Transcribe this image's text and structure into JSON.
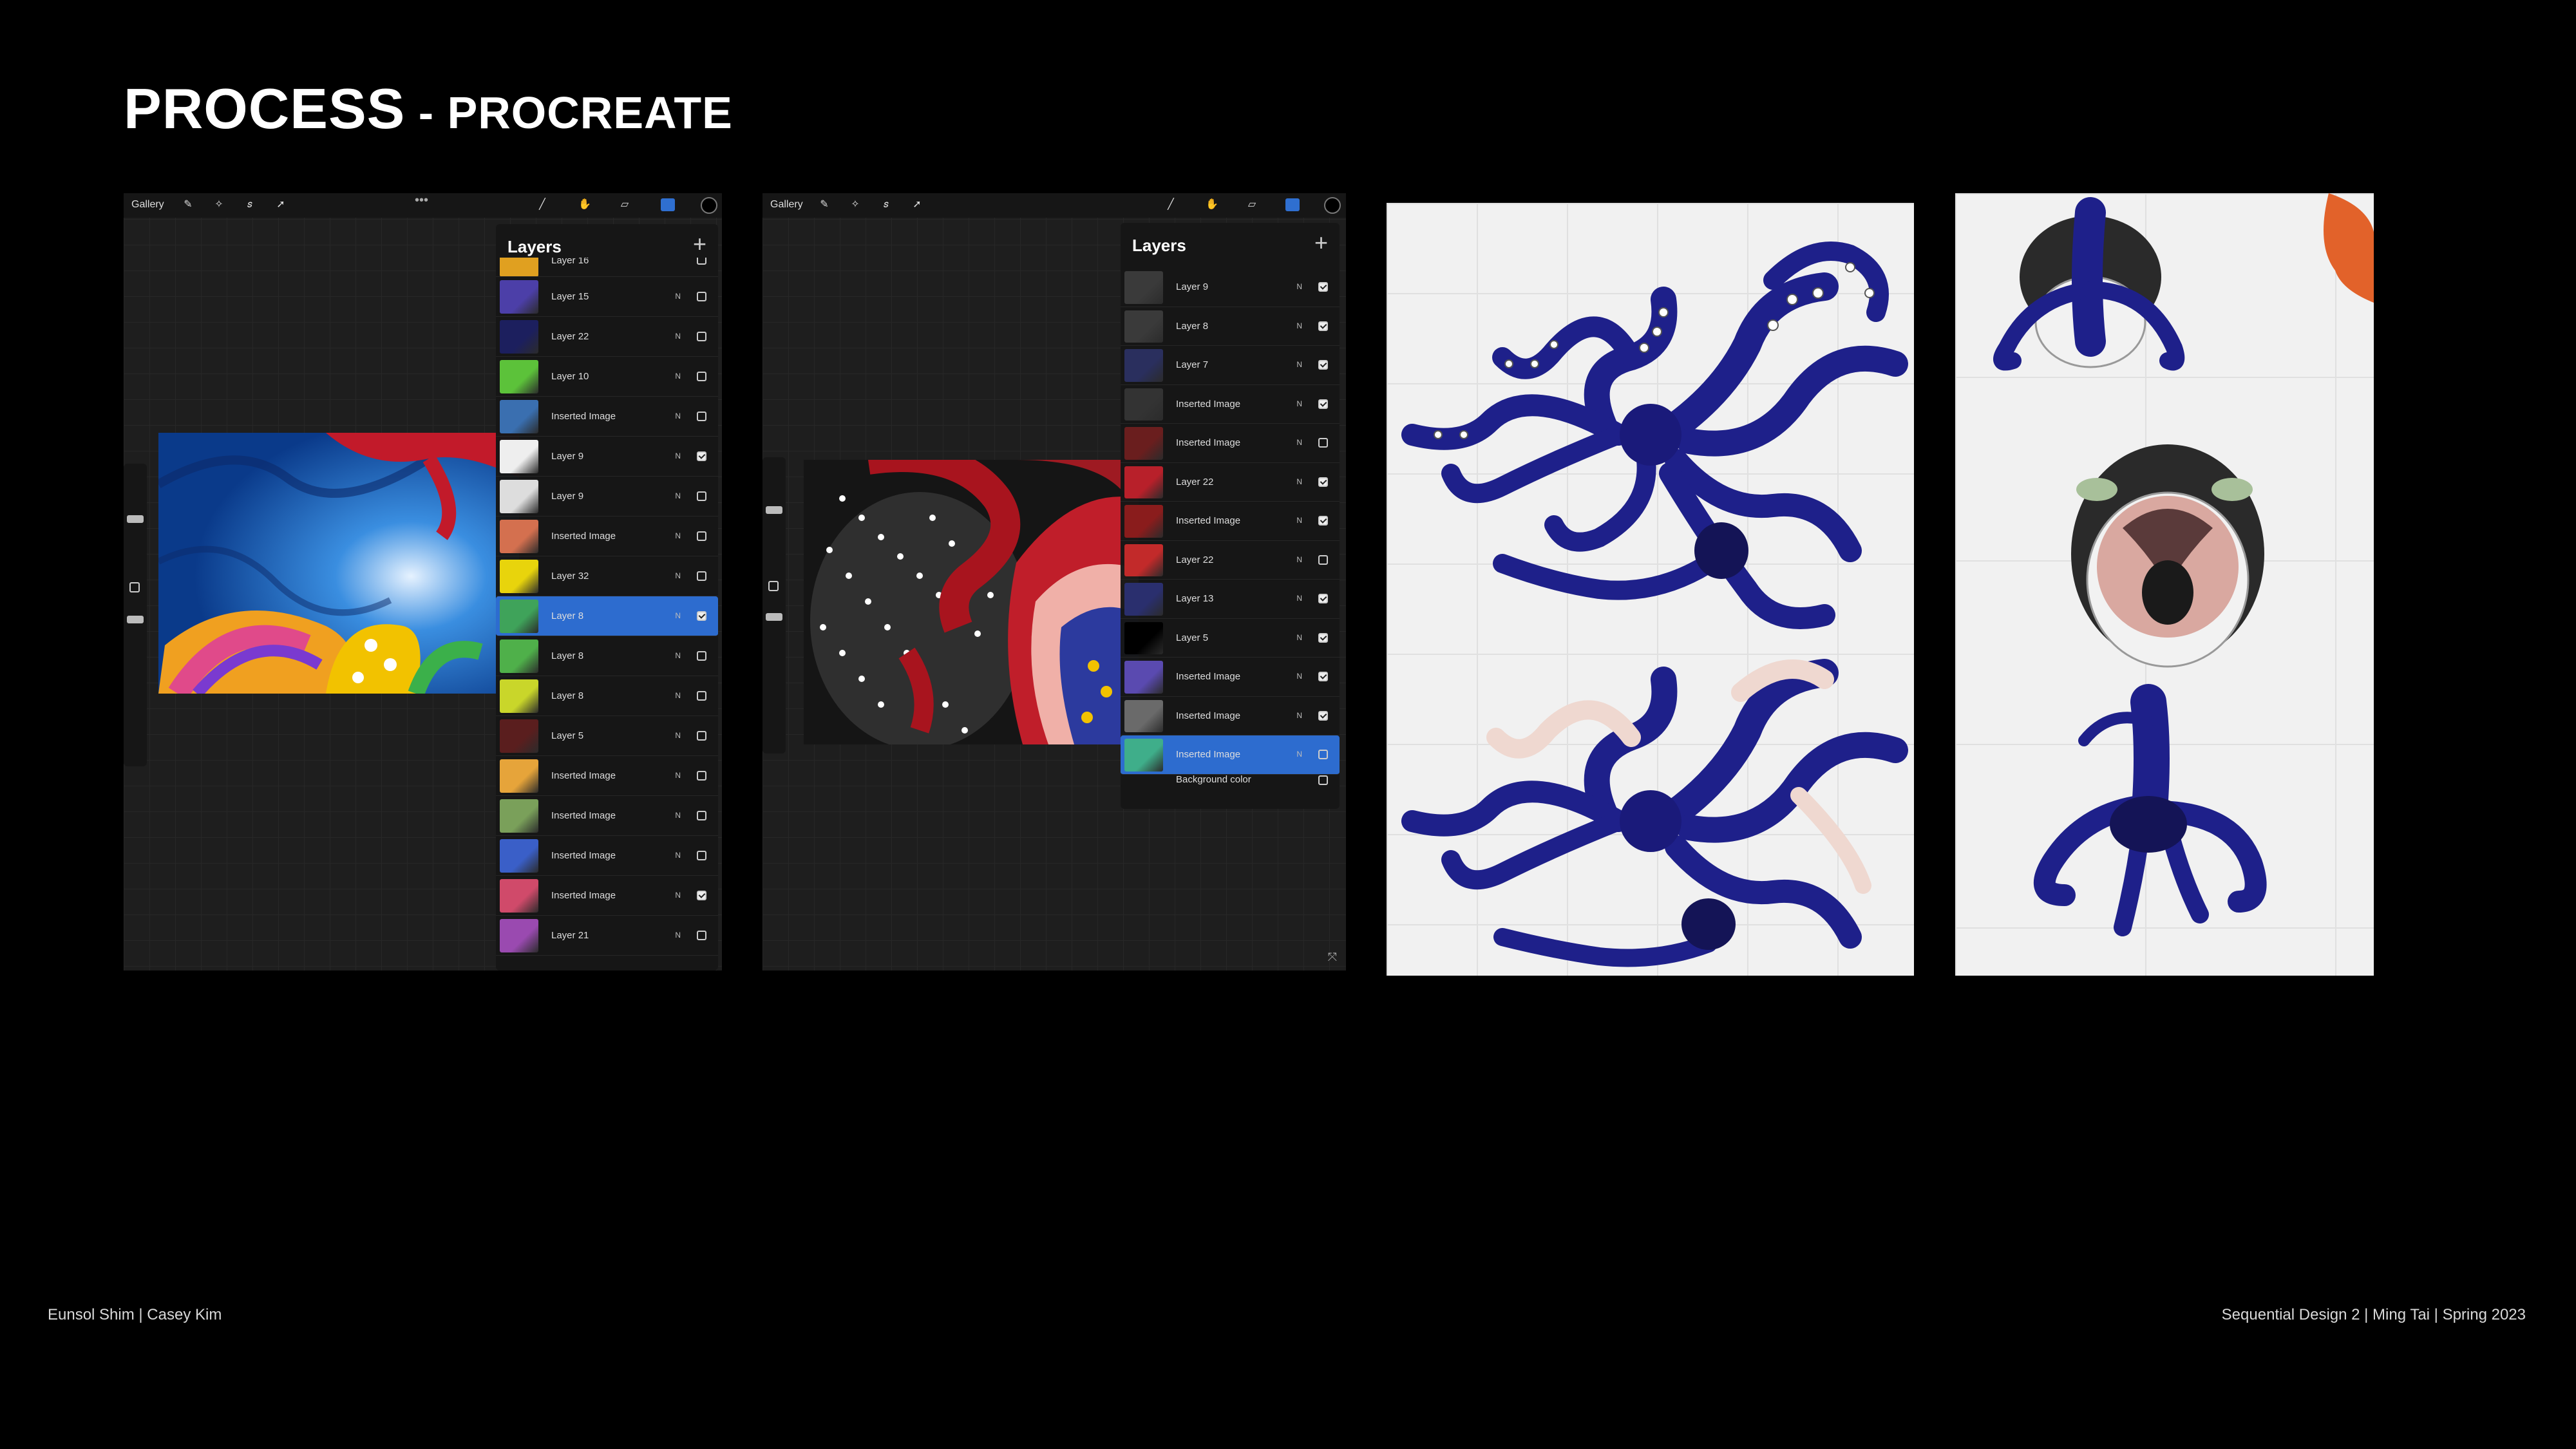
{
  "slide": {
    "title_main": "PROCESS",
    "title_sep": " - ",
    "title_sub": "PROCREATE",
    "footer_left": "Eunsol Shim | Casey Kim",
    "footer_right": "Sequential Design 2 | Ming Tai | Spring 2023"
  },
  "procreate": {
    "gallery_label": "Gallery",
    "more_label": "•••",
    "layers_title": "Layers",
    "add_label": "+",
    "blend_mode": "N"
  },
  "panel1": {
    "partial_top": "Layer 16",
    "layers": [
      {
        "name": "Layer 15",
        "checked": false,
        "selected": false,
        "thumb": "#4c3fa8"
      },
      {
        "name": "Layer 22",
        "checked": false,
        "selected": false,
        "thumb": "#1c1f5e"
      },
      {
        "name": "Layer 10",
        "checked": false,
        "selected": false,
        "thumb": "#5cc23a"
      },
      {
        "name": "Inserted Image",
        "checked": false,
        "selected": false,
        "thumb": "#3a6fb0"
      },
      {
        "name": "Layer 9",
        "checked": true,
        "selected": false,
        "thumb": "#eeeeee"
      },
      {
        "name": "Layer 9",
        "checked": false,
        "selected": false,
        "thumb": "#dddddd"
      },
      {
        "name": "Inserted Image",
        "checked": false,
        "selected": false,
        "thumb": "#d4704f"
      },
      {
        "name": "Layer 32",
        "checked": false,
        "selected": false,
        "thumb": "#e8d40c"
      },
      {
        "name": "Layer 8",
        "checked": true,
        "selected": true,
        "thumb": "#3fa35a"
      },
      {
        "name": "Layer 8",
        "checked": false,
        "selected": false,
        "thumb": "#4fb04a"
      },
      {
        "name": "Layer 8",
        "checked": false,
        "selected": false,
        "thumb": "#c9d62a"
      },
      {
        "name": "Layer 5",
        "checked": false,
        "selected": false,
        "thumb": "#5a1e1e"
      },
      {
        "name": "Inserted Image",
        "checked": false,
        "selected": false,
        "thumb": "#e6a43a"
      },
      {
        "name": "Inserted Image",
        "checked": false,
        "selected": false,
        "thumb": "#7aa05a"
      },
      {
        "name": "Inserted Image",
        "checked": false,
        "selected": false,
        "thumb": "#3a5fc8"
      },
      {
        "name": "Inserted Image",
        "checked": true,
        "selected": false,
        "thumb": "#d04a6a"
      },
      {
        "name": "Layer 21",
        "checked": false,
        "selected": false,
        "thumb": "#9a4ab0"
      }
    ]
  },
  "panel2": {
    "layers": [
      {
        "name": "Layer 9",
        "checked": true,
        "selected": false,
        "thumb": "#3a3a3a"
      },
      {
        "name": "Layer 8",
        "checked": true,
        "selected": false,
        "thumb": "#3a3a3a"
      },
      {
        "name": "Layer 7",
        "checked": true,
        "selected": false,
        "thumb": "#2a2f5e"
      },
      {
        "name": "Inserted Image",
        "checked": true,
        "selected": false,
        "thumb": "#333333"
      },
      {
        "name": "Inserted Image",
        "checked": false,
        "selected": false,
        "thumb": "#6a1e1e"
      },
      {
        "name": "Layer 22",
        "checked": true,
        "selected": false,
        "thumb": "#b8202a"
      },
      {
        "name": "Inserted Image",
        "checked": true,
        "selected": false,
        "thumb": "#8a1c1c"
      },
      {
        "name": "Layer 22",
        "checked": false,
        "selected": false,
        "thumb": "#c22a2a"
      },
      {
        "name": "Layer 13",
        "checked": true,
        "selected": false,
        "thumb": "#2a2f6e"
      },
      {
        "name": "Layer 5",
        "checked": true,
        "selected": false,
        "thumb": "#000000"
      },
      {
        "name": "Inserted Image",
        "checked": true,
        "selected": false,
        "thumb": "#5a4ab0"
      },
      {
        "name": "Inserted Image",
        "checked": true,
        "selected": false,
        "thumb": "#6a6a6a"
      },
      {
        "name": "Inserted Image",
        "checked": false,
        "selected": true,
        "thumb": "#3fae8a"
      }
    ],
    "background_label": "Background color"
  }
}
